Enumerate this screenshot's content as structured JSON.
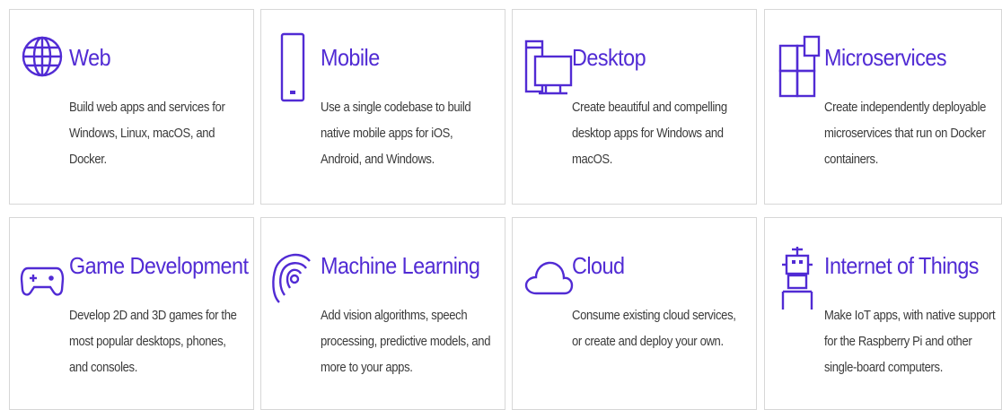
{
  "accent_color": "#512bd4",
  "cards": [
    {
      "icon": "globe-icon",
      "title": "Web",
      "description": "Build web apps and services for Windows, Linux, macOS, and Docker."
    },
    {
      "icon": "mobile-phone-icon",
      "title": "Mobile",
      "description": "Use a single codebase to build native mobile apps for iOS, Android, and Windows."
    },
    {
      "icon": "desktop-icon",
      "title": "Desktop",
      "description": "Create beautiful and compelling desktop apps for Windows and macOS."
    },
    {
      "icon": "microservices-icon",
      "title": "Microservices",
      "description": "Create independently deployable microservices that run on Docker containers."
    },
    {
      "icon": "gamepad-icon",
      "title": "Game Development",
      "description": "Develop 2D and 3D games for the most popular desktops, phones, and consoles."
    },
    {
      "icon": "machine-learning-icon",
      "title": "Machine Learning",
      "description": "Add vision algorithms, speech processing, predictive models, and more to your apps."
    },
    {
      "icon": "cloud-icon",
      "title": "Cloud",
      "description": "Consume existing cloud services, or create and deploy your own."
    },
    {
      "icon": "robot-icon",
      "title": "Internet of Things",
      "description": "Make IoT apps, with native support for the Raspberry Pi and other single-board computers."
    }
  ]
}
